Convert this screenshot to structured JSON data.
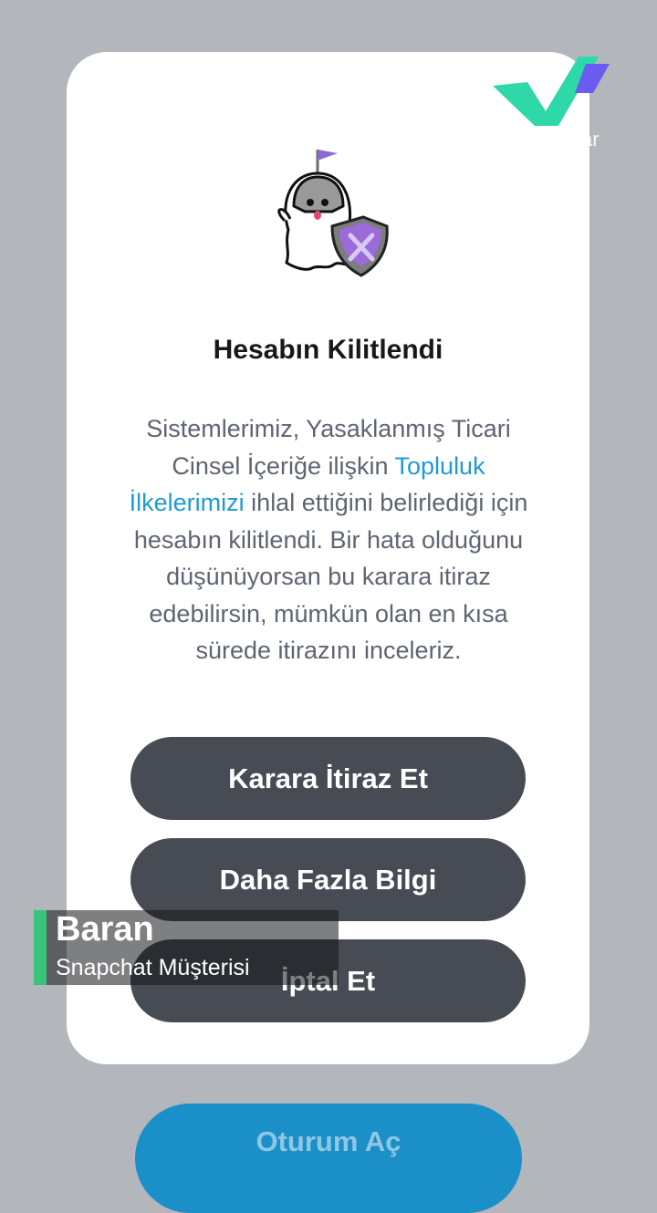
{
  "modal": {
    "title": "Hesabın Kilitlendi",
    "body_part1": "Sistemlerimiz, Yasaklanmış Ticari Cinsel İçeriğe ilişkin ",
    "body_link": "Topluluk İlkelerimizi",
    "body_part2": " ihlal ettiğini belirlediği için hesabın kilitlendi. Bir hata olduğunu düşünüyorsan bu karara itiraz edebilirsin, mümkün olan en kısa sürede itirazını inceleriz.",
    "buttons": {
      "appeal": "Karara İtiraz Et",
      "more_info": "Daha Fazla Bilgi",
      "cancel": "İptal Et"
    },
    "mascot_icon": "ghost-knight-shield-icon"
  },
  "background": {
    "login_button": "Oturum Aç"
  },
  "overlay": {
    "logo_suffix": "ar",
    "lower_third": {
      "name": "Baran",
      "role": "Snapchat Müşterisi"
    }
  },
  "colors": {
    "link": "#1f9ad6",
    "button_dark": "#474b53",
    "login_blue": "#1a8fc8",
    "accent_green": "#39c27a"
  }
}
